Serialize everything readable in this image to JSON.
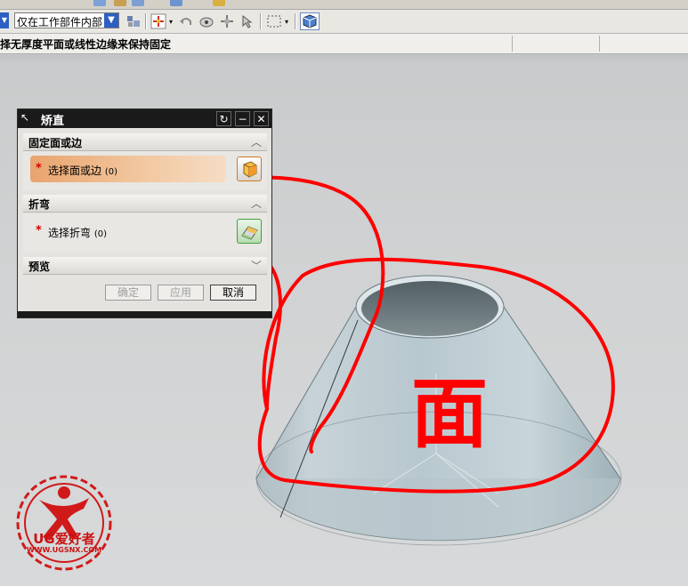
{
  "toolbar": {
    "filter_value": "仅在工作部件内部",
    "icons": [
      "assembly-icon",
      "snap-point-icon",
      "undo-icon",
      "view-icon",
      "move-icon",
      "select-box-icon",
      "cube-icon"
    ]
  },
  "status": {
    "prompt": "择无厚度平面或线性边缘来保持固定"
  },
  "dialog": {
    "title": "矫直",
    "sections": {
      "fixed": {
        "header": "固定面或边",
        "select_label": "选择面或边",
        "count": "(0)"
      },
      "bend": {
        "header": "折弯",
        "select_label": "选择折弯",
        "count": "(0)"
      },
      "preview": {
        "header": "预览"
      }
    },
    "buttons": {
      "ok": "确定",
      "apply": "应用",
      "cancel": "取消"
    }
  },
  "annotation": {
    "text": "面"
  },
  "logo": {
    "brand": "UG爱好者",
    "url": "WWW.UGSNX.COM"
  },
  "colors": {
    "accent_orange": "#e3a06a",
    "annotation_red": "#ff0000",
    "title_bar": "#1a1a1a"
  }
}
